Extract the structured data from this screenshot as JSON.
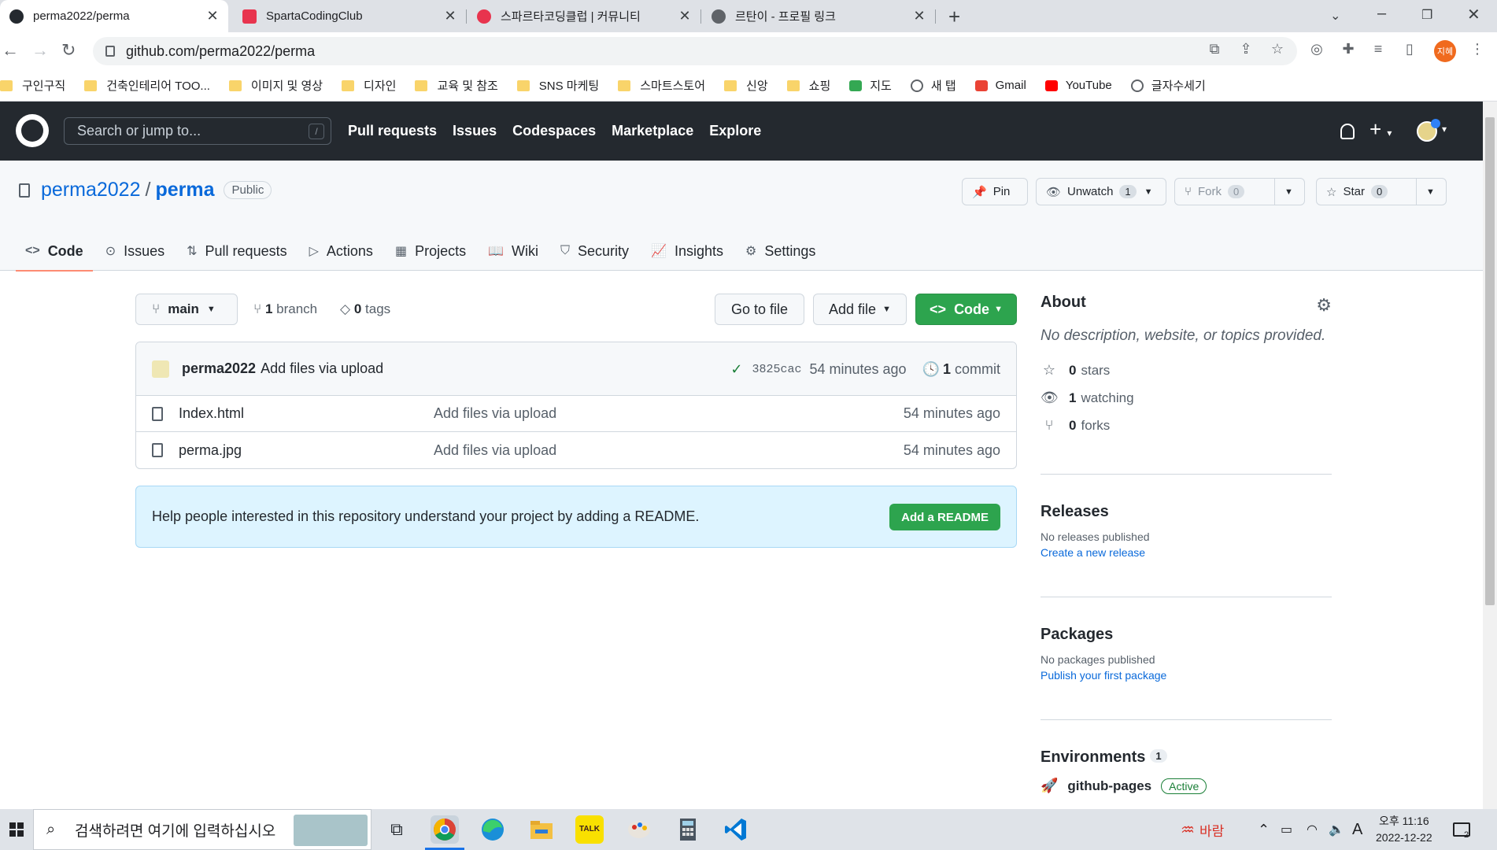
{
  "browser": {
    "tabs": [
      {
        "title": "perma2022/perma",
        "active": true
      },
      {
        "title": "SpartaCodingClub",
        "active": false
      },
      {
        "title": "스파르타코딩클럽 | 커뮤니티",
        "active": false
      },
      {
        "title": "르탄이 - 프로필 링크",
        "active": false
      }
    ],
    "url": "github.com/perma2022/perma",
    "profile_initial": "지혜",
    "bookmarks": [
      {
        "label": "구인구직",
        "icon": "folder-icon"
      },
      {
        "label": "건축인테리어 TOO...",
        "icon": "folder-icon"
      },
      {
        "label": "이미지 및 영상",
        "icon": "folder-icon"
      },
      {
        "label": "디자인",
        "icon": "folder-icon"
      },
      {
        "label": "교육 및 참조",
        "icon": "folder-icon"
      },
      {
        "label": "SNS 마케팅",
        "icon": "folder-icon"
      },
      {
        "label": "스마트스토어",
        "icon": "folder-icon"
      },
      {
        "label": "신앙",
        "icon": "folder-icon"
      },
      {
        "label": "쇼핑",
        "icon": "folder-icon"
      },
      {
        "label": "지도",
        "icon": "maps-icon"
      },
      {
        "label": "새 탭",
        "icon": "globe-icon"
      },
      {
        "label": "Gmail",
        "icon": "gmail-icon"
      },
      {
        "label": "YouTube",
        "icon": "youtube-icon"
      },
      {
        "label": "글자수세기",
        "icon": "globe-icon"
      }
    ]
  },
  "github": {
    "search_placeholder": "Search or jump to...",
    "search_shortcut": "/",
    "nav": [
      "Pull requests",
      "Issues",
      "Codespaces",
      "Marketplace",
      "Explore"
    ]
  },
  "repo": {
    "owner": "perma2022",
    "name": "perma",
    "visibility": "Public",
    "pin_label": "Pin",
    "watch_label": "Unwatch",
    "watch_count": "1",
    "fork_label": "Fork",
    "fork_count": "0",
    "star_label": "Star",
    "star_count": "0",
    "tabs": [
      {
        "label": "Code",
        "icon": "code-icon",
        "selected": true
      },
      {
        "label": "Issues",
        "icon": "issue-icon"
      },
      {
        "label": "Pull requests",
        "icon": "pull-request-icon"
      },
      {
        "label": "Actions",
        "icon": "play-icon"
      },
      {
        "label": "Projects",
        "icon": "table-icon"
      },
      {
        "label": "Wiki",
        "icon": "book-icon"
      },
      {
        "label": "Security",
        "icon": "shield-icon"
      },
      {
        "label": "Insights",
        "icon": "graph-icon"
      },
      {
        "label": "Settings",
        "icon": "gear-icon"
      }
    ]
  },
  "main": {
    "branch": "main",
    "branch_count": "1",
    "branch_word": "branch",
    "tag_count": "0",
    "tag_word": "tags",
    "go_to_file": "Go to file",
    "add_file": "Add file",
    "code_btn": "Code",
    "commit": {
      "user": "perma2022",
      "message": "Add files via upload",
      "sha": "3825cac",
      "age": "54 minutes ago",
      "count": "1",
      "count_word": "commit"
    },
    "files": [
      {
        "name": "Index.html",
        "message": "Add files via upload",
        "age": "54 minutes ago"
      },
      {
        "name": "perma.jpg",
        "message": "Add files via upload",
        "age": "54 minutes ago"
      }
    ],
    "readme_text": "Help people interested in this repository understand your project by adding a README.",
    "readme_btn": "Add a README"
  },
  "sidebar": {
    "about_title": "About",
    "about_desc": "No description, website, or topics provided.",
    "stars": {
      "count": "0",
      "label": "stars"
    },
    "watching": {
      "count": "1",
      "label": "watching"
    },
    "forks": {
      "count": "0",
      "label": "forks"
    },
    "releases_title": "Releases",
    "releases_text": "No releases published",
    "releases_link": "Create a new release",
    "packages_title": "Packages",
    "packages_text": "No packages published",
    "packages_link": "Publish your first package",
    "env_title": "Environments",
    "env_count": "1",
    "env_name": "github-pages",
    "env_status": "Active"
  },
  "taskbar": {
    "search_placeholder": "검색하려면 여기에 입력하십시오",
    "weather": "바람",
    "ime": "A",
    "time": "오후 11:16",
    "date": "2022-12-22",
    "notifications": "2"
  },
  "colors": {
    "accent": "#0969da",
    "green": "#2da44e",
    "header": "#24292f",
    "tab_underline": "#fd8c73"
  }
}
